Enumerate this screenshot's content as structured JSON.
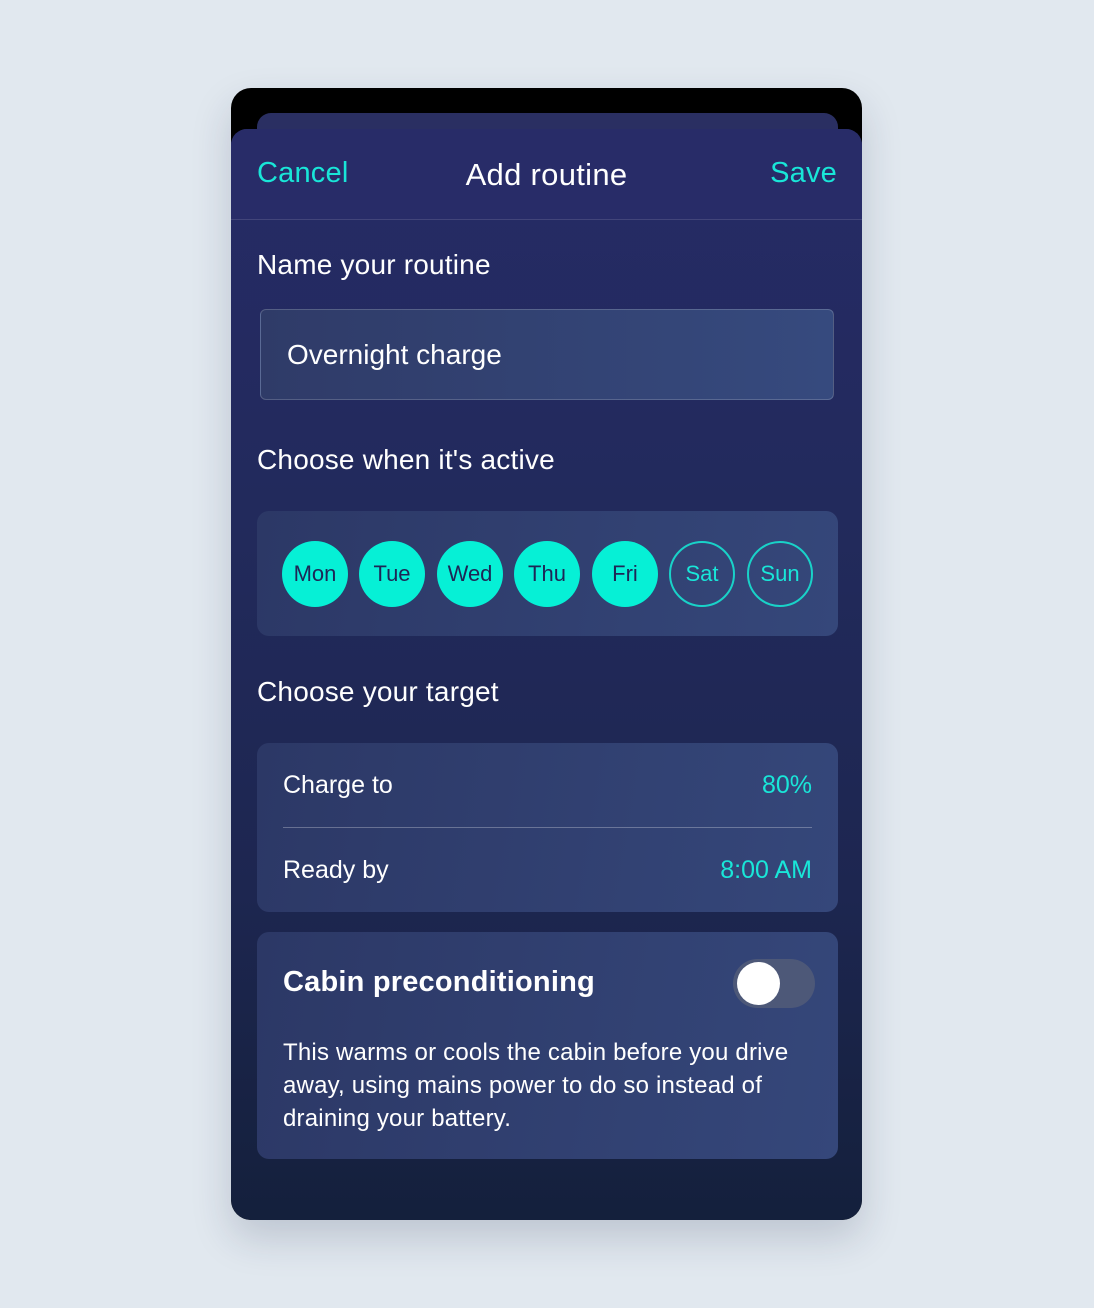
{
  "header": {
    "cancel_label": "Cancel",
    "title": "Add routine",
    "save_label": "Save"
  },
  "name_section": {
    "label": "Name your routine",
    "input_value": "Overnight charge"
  },
  "schedule_section": {
    "label": "Choose when it's active",
    "days": [
      {
        "label": "Mon",
        "selected": true
      },
      {
        "label": "Tue",
        "selected": true
      },
      {
        "label": "Wed",
        "selected": true
      },
      {
        "label": "Thu",
        "selected": true
      },
      {
        "label": "Fri",
        "selected": true
      },
      {
        "label": "Sat",
        "selected": false
      },
      {
        "label": "Sun",
        "selected": false
      }
    ]
  },
  "target_section": {
    "label": "Choose your target",
    "charge_to_label": "Charge to",
    "charge_to_value": "80%",
    "ready_by_label": "Ready by",
    "ready_by_value": "8:00 AM"
  },
  "cabin": {
    "title": "Cabin preconditioning",
    "enabled": false,
    "description": "This warms or cools the cabin before you drive away, using mains power to do so instead of draining your battery."
  },
  "colors": {
    "accent": "#06f0d6",
    "background": "#e1e8ef",
    "sheet": "#262b66"
  }
}
